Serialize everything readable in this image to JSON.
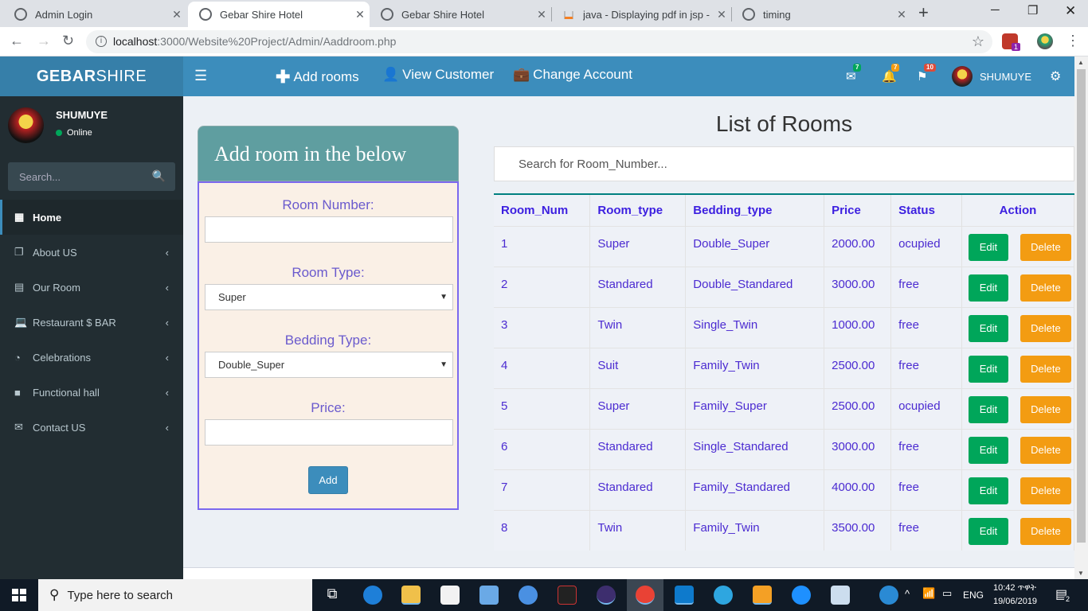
{
  "browser": {
    "tabs": [
      {
        "title": "Admin Login",
        "active": false
      },
      {
        "title": "Gebar Shire Hotel",
        "active": true
      },
      {
        "title": "Gebar Shire Hotel",
        "active": false
      },
      {
        "title": "java - Displaying pdf in jsp - St",
        "active": false
      },
      {
        "title": "timing",
        "active": false
      }
    ],
    "url_host": "localhost",
    "url_path": ":3000/Website%20Project/Admin/Aaddroom.php",
    "ext_badge": "1"
  },
  "header": {
    "logo_bold": "GEBAR",
    "logo_light": "SHIRE",
    "nav": [
      {
        "label": "Add rooms",
        "icon": "plus-icon"
      },
      {
        "label": "View Customer",
        "icon": "user-icon"
      },
      {
        "label": "Change Account",
        "icon": "briefcase-icon"
      }
    ],
    "mail_count": "7",
    "bell_count": "7",
    "flag_count": "10",
    "user": "SHUMUYE",
    "colors": {
      "header": "#3c8dbc",
      "logo": "#367fa9",
      "sidebar": "#222d32"
    }
  },
  "sidebar": {
    "user": "SHUMUYE",
    "status": "Online",
    "search_placeholder": "Search...",
    "items": [
      {
        "label": "Home",
        "icon": "dashboard-icon"
      },
      {
        "label": "About US",
        "icon": "copy-icon"
      },
      {
        "label": "Our Room",
        "icon": "calendar-icon"
      },
      {
        "label": "Restaurant $ BAR",
        "icon": "laptop-icon"
      },
      {
        "label": "Celebrations",
        "icon": "gauge-icon"
      },
      {
        "label": "Functional hall",
        "icon": "folder-icon"
      },
      {
        "label": "Contact US",
        "icon": "envelope-icon"
      }
    ]
  },
  "form": {
    "title": "Add room in the below",
    "room_number_label": "Room Number:",
    "room_number_value": "",
    "room_type_label": "Room Type:",
    "room_type_value": "Super",
    "bedding_type_label": "Bedding Type:",
    "bedding_type_value": "Double_Super",
    "price_label": "Price:",
    "price_value": "",
    "add_label": "Add"
  },
  "rooms": {
    "title": "List of Rooms",
    "search_placeholder": "Search for Room_Number...",
    "columns": [
      "Room_Num",
      "Room_type",
      "Bedding_type",
      "Price",
      "Status",
      "Action"
    ],
    "edit_label": "Edit",
    "delete_label": "Delete",
    "rows": [
      {
        "num": "1",
        "type": "Super",
        "bedding": "Double_Super",
        "price": "2000.00",
        "status": "ocupied"
      },
      {
        "num": "2",
        "type": "Standared",
        "bedding": "Double_Standared",
        "price": "3000.00",
        "status": "free"
      },
      {
        "num": "3",
        "type": "Twin",
        "bedding": "Single_Twin",
        "price": "1000.00",
        "status": "free"
      },
      {
        "num": "4",
        "type": "Suit",
        "bedding": "Family_Twin",
        "price": "2500.00",
        "status": "free"
      },
      {
        "num": "5",
        "type": "Super",
        "bedding": "Family_Super",
        "price": "2500.00",
        "status": "ocupied"
      },
      {
        "num": "6",
        "type": "Standared",
        "bedding": "Single_Standared",
        "price": "3000.00",
        "status": "free"
      },
      {
        "num": "7",
        "type": "Standared",
        "bedding": "Family_Standared",
        "price": "4000.00",
        "status": "free"
      },
      {
        "num": "8",
        "type": "Twin",
        "bedding": "Family_Twin",
        "price": "3500.00",
        "status": "free"
      }
    ]
  },
  "taskbar": {
    "search_placeholder": "Type here to search",
    "lang": "ENG",
    "time": "10:42 ጥዋት",
    "date": "19/06/2019",
    "notif_count": "2"
  }
}
